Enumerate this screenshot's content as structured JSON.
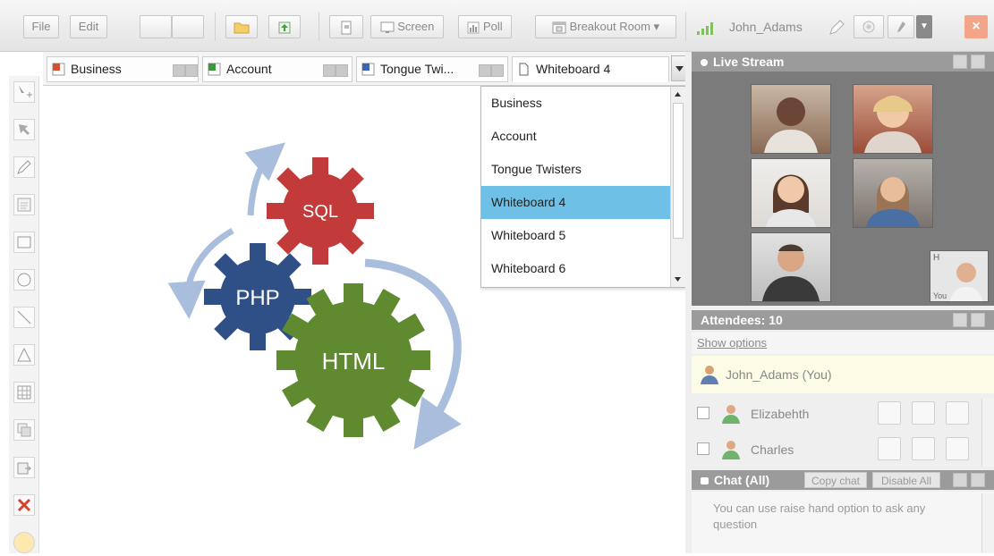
{
  "toolbar": {
    "file": "File",
    "edit": "Edit",
    "screen": "Screen",
    "poll": "Poll",
    "breakout": "Breakout Room ▾",
    "user": "John_Adams",
    "close": "×"
  },
  "tabs": [
    {
      "label": "Business",
      "icon": "ppt-file-icon"
    },
    {
      "label": "Account",
      "icon": "excel-file-icon"
    },
    {
      "label": "Tongue Twi...",
      "icon": "word-file-icon"
    },
    {
      "label": "Whiteboard 4",
      "icon": "blank-page-icon"
    }
  ],
  "dropdown": {
    "items": [
      "Business",
      "Account",
      "Tongue Twisters",
      "Whiteboard 4",
      "Whiteboard 5",
      "Whiteboard 6"
    ],
    "selected": "Whiteboard 4"
  },
  "diagram": {
    "gears": [
      {
        "label": "SQL",
        "color": "#c23a3a"
      },
      {
        "label": "PHP",
        "color": "#2f4f87"
      },
      {
        "label": "HTML",
        "color": "#5f8a2f"
      }
    ],
    "arrow_color": "#a9bedc"
  },
  "live_stream": {
    "title": "Live Stream",
    "self_view_label": "H",
    "self_view_caption": "You"
  },
  "attendees": {
    "title": "Attendees: 10",
    "show_options": "Show options",
    "me": "John_Adams (You)",
    "list": [
      "Elizabehth",
      "Charles"
    ]
  },
  "chat": {
    "title": "Chat (All)",
    "copy": "Copy chat",
    "disable": "Disable All",
    "message": "You can use raise hand option to ask any question"
  }
}
